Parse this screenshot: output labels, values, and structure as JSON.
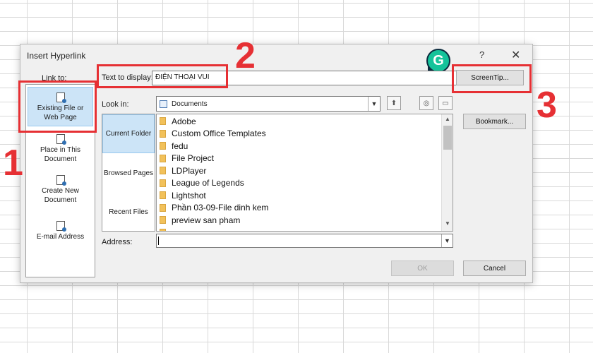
{
  "dialog": {
    "title": "Insert Hyperlink",
    "help": "?",
    "close": "✕"
  },
  "grammarly": {
    "letter": "G"
  },
  "link_to": {
    "label": "Link to:",
    "items": [
      {
        "line1": "Existing File or",
        "line2": "Web Page"
      },
      {
        "line1": "Place in This",
        "line2": "Document"
      },
      {
        "line1": "Create New",
        "line2": "Document"
      },
      {
        "line1": "E-mail Address",
        "line2": ""
      }
    ]
  },
  "text_to_display": {
    "label": "Text to display:",
    "value": "ĐIỆN THOẠI VUI"
  },
  "look_in": {
    "label": "Look in:",
    "value": "Documents"
  },
  "nav": {
    "items": [
      "Current Folder",
      "Browsed Pages",
      "Recent Files"
    ]
  },
  "files": [
    "Adobe",
    "Custom Office Templates",
    "fedu",
    "File Project",
    "LDPlayer",
    "League of Legends",
    "Lightshot",
    "Phần 03-09-File dinh kem",
    "preview san pham"
  ],
  "address": {
    "label": "Address:",
    "value": ""
  },
  "buttons": {
    "screentip": "ScreenTip...",
    "bookmark": "Bookmark...",
    "ok": "OK",
    "cancel": "Cancel"
  },
  "annotations": {
    "one": "1",
    "two": "2",
    "three": "3"
  },
  "colors": {
    "annotation": "#e63034",
    "selection": "#cce4f7",
    "grammarly": "#15c39a"
  }
}
